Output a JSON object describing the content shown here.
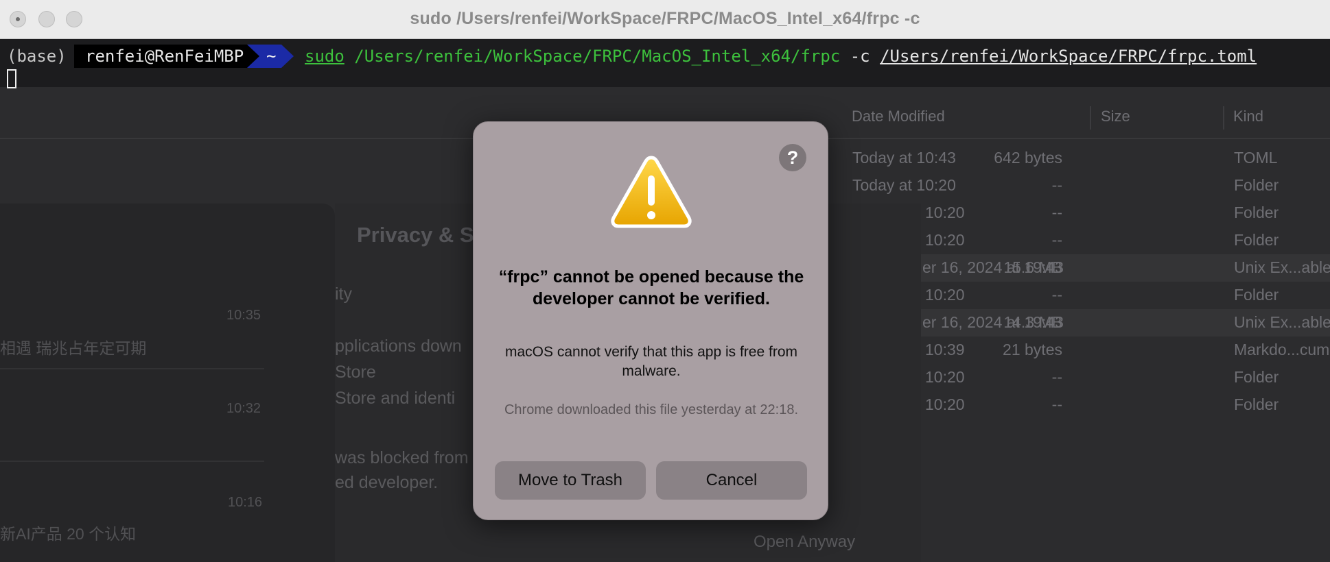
{
  "window": {
    "title": "sudo /Users/renfei/WorkSpace/FRPC/MacOS_Intel_x64/frpc -c"
  },
  "terminal": {
    "env": "(base)",
    "user_host": "renfei@RenFeiMBP",
    "cwd": "~",
    "cmd_sudo": "sudo",
    "cmd_path": "/Users/renfei/WorkSpace/FRPC/MacOS_Intel_x64/frpc",
    "cmd_flag": "-c",
    "cmd_arg": "/Users/renfei/WorkSpace/FRPC/frpc.toml"
  },
  "finder": {
    "columns": {
      "date": "Date Modified",
      "size": "Size",
      "kind": "Kind"
    },
    "rows": [
      {
        "date": "Today at 10:43",
        "size": "642 bytes",
        "kind": "TOML"
      },
      {
        "date": "Today at 10:20",
        "size": "--",
        "kind": "Folder"
      },
      {
        "date": "10:20",
        "size": "--",
        "kind": "Folder"
      },
      {
        "date": "10:20",
        "size": "--",
        "kind": "Folder"
      },
      {
        "date": "er 16, 2024 at 19:43",
        "size": "15.6 MB",
        "kind": "Unix Ex...able"
      },
      {
        "date": "10:20",
        "size": "--",
        "kind": "Folder"
      },
      {
        "date": "er 16, 2024 at 19:43",
        "size": "14.3 MB",
        "kind": "Unix Ex...able"
      },
      {
        "date": "10:39",
        "size": "21 bytes",
        "kind": "Markdo...cument"
      },
      {
        "date": "10:20",
        "size": "--",
        "kind": "Folder"
      },
      {
        "date": "10:20",
        "size": "--",
        "kind": "Folder"
      }
    ]
  },
  "sidebar_panel": {
    "items": [
      {
        "time": "10:35",
        "text": "相遇 瑞兆占年定可期"
      },
      {
        "time": "10:32",
        "text": ""
      },
      {
        "time": "10:16",
        "text": "新AI产品 20 个认知"
      }
    ]
  },
  "privacy": {
    "title": "Privacy & Se",
    "lines": {
      "heading": "ity",
      "apps": "pplications down",
      "store": "Store",
      "store_dev": "Store and identi",
      "blocked": "was blocked from",
      "developer": "ed developer.",
      "open_anyway": "Open Anyway"
    }
  },
  "dialog": {
    "help": "?",
    "title": "“frpc” cannot be opened because the developer cannot be verified.",
    "message": "macOS cannot verify that this app is free from malware.",
    "note": "Chrome downloaded this file yesterday at 22:18.",
    "move_to_trash": "Move to Trash",
    "cancel": "Cancel"
  },
  "colors": {
    "dialog_bg": "#a99fa3",
    "terminal_bg": "#1c1c1e",
    "prompt_home": "#1b2aa6",
    "command_green": "#3dc13d",
    "warning_yellow": "#f2b705"
  }
}
